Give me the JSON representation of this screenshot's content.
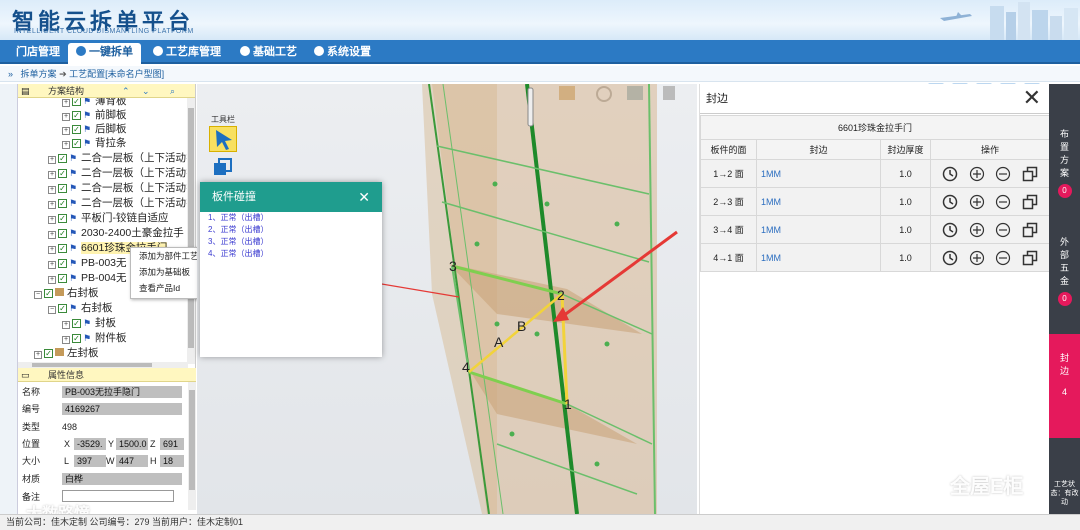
{
  "header": {
    "title": "智能云拆单平台",
    "subtitle": "INTELLIGENT CLOUD DISMANTLING PLATFORM"
  },
  "nav": {
    "items": [
      "门店管理",
      "一键拆单",
      "工艺库管理",
      "基础工艺",
      "系统设置"
    ],
    "active": "一键拆单"
  },
  "toolbar_icons": [
    "calendar-icon",
    "clipboard-icon",
    "user-icon",
    "gear-icon",
    "logout-icon"
  ],
  "breadcrumb": {
    "part1": "拆单方案",
    "part2": "工艺配置[未命名户型图]"
  },
  "tree_panel": {
    "title": "方案结构",
    "items": [
      {
        "label": "薄背板",
        "type": "leaf"
      },
      {
        "label": "前脚板",
        "type": "leaf"
      },
      {
        "label": "后脚板",
        "type": "leaf"
      },
      {
        "label": "背拉条",
        "type": "leaf"
      },
      {
        "label": "二合一层板（上下活动扌",
        "type": "item"
      },
      {
        "label": "二合一层板（上下活动扌",
        "type": "item"
      },
      {
        "label": "二合一层板（上下活动扌",
        "type": "item"
      },
      {
        "label": "二合一层板（上下活动扌",
        "type": "item"
      },
      {
        "label": "平板门-铰链自适应",
        "type": "item"
      },
      {
        "label": "2030-2400土豪金拉手",
        "type": "item"
      },
      {
        "label": "6601珍珠金拉手门",
        "type": "selected"
      },
      {
        "label": "PB-003无",
        "type": "item"
      },
      {
        "label": "PB-004无",
        "type": "item"
      },
      {
        "label": "右封板",
        "type": "group"
      },
      {
        "label": "右封板",
        "type": "subgroup"
      },
      {
        "label": "封板",
        "type": "sub"
      },
      {
        "label": "附件板",
        "type": "sub"
      },
      {
        "label": "左封板",
        "type": "group"
      }
    ]
  },
  "context_menu": {
    "items": [
      "添加为部件工艺",
      "添加为基础板",
      "查看产品Id"
    ]
  },
  "property_panel": {
    "title": "属性信息",
    "name_label": "名称",
    "name_value": "PB-003无拉手隐门",
    "code_label": "编号",
    "code_value": "4169267",
    "type_label": "类型",
    "type_value": "498",
    "pos_label": "位置",
    "x_label": "X",
    "x_value": "-3529.",
    "y_label": "Y",
    "y_value": "1500.0",
    "z_label": "Z",
    "z_value": "691",
    "size_label": "大小",
    "l_label": "L",
    "l_value": "397",
    "w_label": "W",
    "w_value": "447",
    "h_label": "H",
    "h_value": "18",
    "material_label": "材质",
    "material_value": "白桦",
    "note_label": "备注",
    "note_value": ""
  },
  "viewport": {
    "toolbar_label": "工具栏",
    "labels": [
      "1",
      "2",
      "3",
      "4",
      "A",
      "B"
    ]
  },
  "collision_dialog": {
    "title": "板件碰撞",
    "items": [
      "1、正常（出槽）",
      "2、正常（出槽）",
      "3、正常（出槽）",
      "4、正常（出槽）"
    ]
  },
  "edge_panel": {
    "title": "封边",
    "caption": "6601珍珠金拉手门",
    "headers": [
      "板件的面",
      "封边",
      "封边厚度",
      "操作"
    ],
    "rows": [
      {
        "face": "1→2 面",
        "edge": "1MM",
        "thickness": "1.0"
      },
      {
        "face": "2→3 面",
        "edge": "1MM",
        "thickness": "1.0"
      },
      {
        "face": "3→4 面",
        "edge": "1MM",
        "thickness": "1.0"
      },
      {
        "face": "4→1 面",
        "edge": "1MM",
        "thickness": "1.0"
      }
    ]
  },
  "side_tabs": [
    {
      "label": "布置方案",
      "badge": "0"
    },
    {
      "label": "外部五金",
      "badge": "0"
    },
    {
      "label": "封边",
      "badge": "4"
    }
  ],
  "side_status": "工艺状态：有改动",
  "footer": "当前公司：佳木定制   公司编号：279   当前用户：佳木定制01",
  "watermark": {
    "left": "大数路憧",
    "right": "全屋E柜"
  },
  "colors": {
    "nav": "#2c7ac4",
    "dialog_head": "#1f9d8e",
    "accent": "#e5195c",
    "side": "#3a3f48"
  }
}
